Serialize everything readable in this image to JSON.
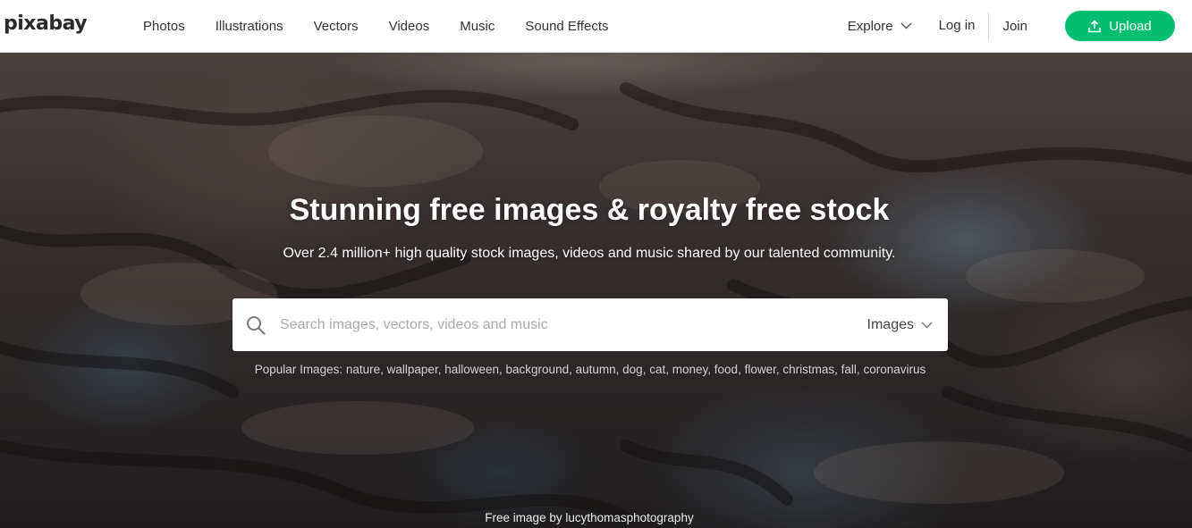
{
  "header": {
    "logo": "pixabay",
    "nav": [
      "Photos",
      "Illustrations",
      "Vectors",
      "Videos",
      "Music",
      "Sound Effects"
    ],
    "explore_label": "Explore",
    "login_label": "Log in",
    "join_label": "Join",
    "upload_label": "Upload"
  },
  "hero": {
    "title": "Stunning free images & royalty free stock",
    "subtitle": "Over 2.4 million+ high quality stock images, videos and music shared by our talented community.",
    "search": {
      "placeholder": "Search images, vectors, videos and music",
      "value": "",
      "type_selected": "Images"
    },
    "popular_label": "Popular Images:",
    "popular_tags": [
      "nature",
      "wallpaper",
      "halloween",
      "background",
      "autumn",
      "dog",
      "cat",
      "money",
      "food",
      "flower",
      "christmas",
      "fall",
      "coronavirus"
    ],
    "credit_prefix": "Free image by",
    "credit_author": "lucythomasphotography"
  },
  "colors": {
    "accent": "#02be6e",
    "header_bg": "#ffffff",
    "text": "#333333"
  },
  "icons": [
    "chevron-down-icon",
    "upload-icon",
    "search-icon"
  ]
}
